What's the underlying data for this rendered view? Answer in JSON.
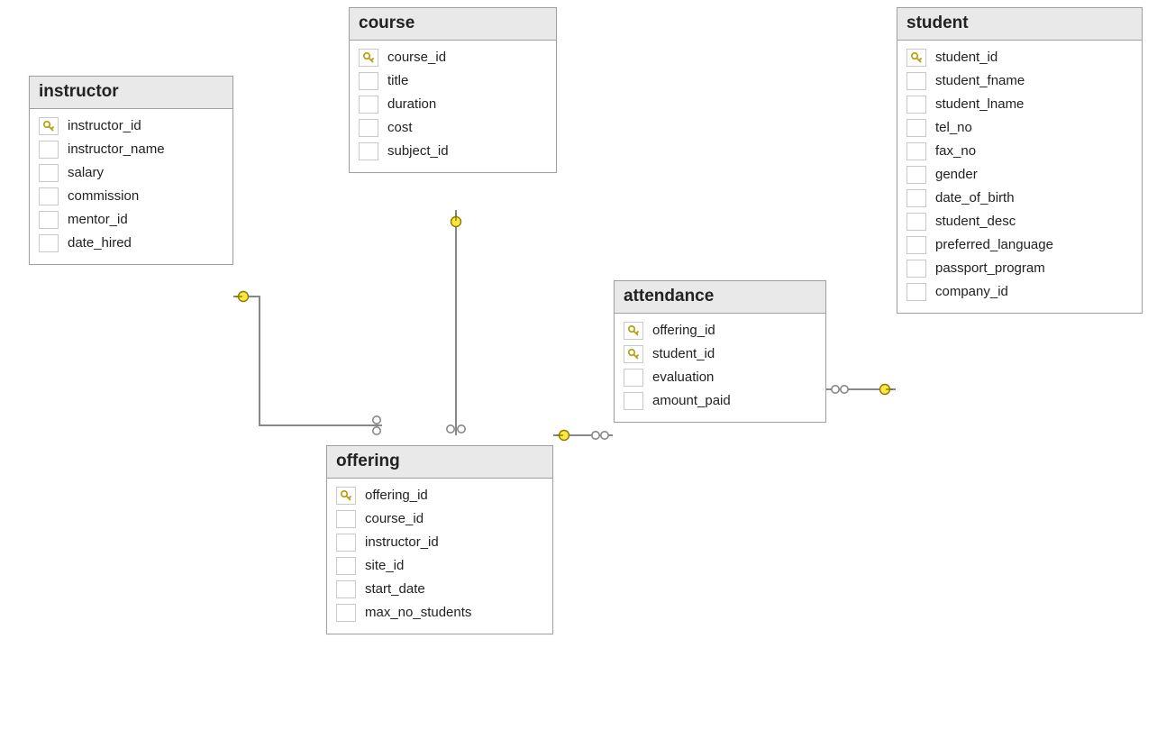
{
  "entities": {
    "instructor": {
      "name": "instructor",
      "columns": [
        {
          "name": "instructor_id",
          "pk": true
        },
        {
          "name": "instructor_name",
          "pk": false
        },
        {
          "name": "salary",
          "pk": false
        },
        {
          "name": "commission",
          "pk": false
        },
        {
          "name": "mentor_id",
          "pk": false
        },
        {
          "name": "date_hired",
          "pk": false
        }
      ]
    },
    "course": {
      "name": "course",
      "columns": [
        {
          "name": "course_id",
          "pk": true
        },
        {
          "name": "title",
          "pk": false
        },
        {
          "name": "duration",
          "pk": false
        },
        {
          "name": "cost",
          "pk": false
        },
        {
          "name": "subject_id",
          "pk": false
        }
      ]
    },
    "attendance": {
      "name": "attendance",
      "columns": [
        {
          "name": "offering_id",
          "pk": true
        },
        {
          "name": "student_id",
          "pk": true
        },
        {
          "name": "evaluation",
          "pk": false
        },
        {
          "name": "amount_paid",
          "pk": false
        }
      ]
    },
    "student": {
      "name": "student",
      "columns": [
        {
          "name": "student_id",
          "pk": true
        },
        {
          "name": "student_fname",
          "pk": false
        },
        {
          "name": "student_lname",
          "pk": false
        },
        {
          "name": "tel_no",
          "pk": false
        },
        {
          "name": "fax_no",
          "pk": false
        },
        {
          "name": "gender",
          "pk": false
        },
        {
          "name": "date_of_birth",
          "pk": false
        },
        {
          "name": "student_desc",
          "pk": false
        },
        {
          "name": "preferred_language",
          "pk": false
        },
        {
          "name": "passport_program",
          "pk": false
        },
        {
          "name": "company_id",
          "pk": false
        }
      ]
    },
    "offering": {
      "name": "offering",
      "columns": [
        {
          "name": "offering_id",
          "pk": true
        },
        {
          "name": "course_id",
          "pk": false
        },
        {
          "name": "instructor_id",
          "pk": false
        },
        {
          "name": "site_id",
          "pk": false
        },
        {
          "name": "start_date",
          "pk": false
        },
        {
          "name": "max_no_students",
          "pk": false
        }
      ]
    }
  },
  "relationships": [
    {
      "from": "instructor",
      "to": "offering",
      "from_card": "one",
      "to_card": "many"
    },
    {
      "from": "course",
      "to": "offering",
      "from_card": "one",
      "to_card": "many"
    },
    {
      "from": "offering",
      "to": "attendance",
      "from_card": "one",
      "to_card": "many"
    },
    {
      "from": "student",
      "to": "attendance",
      "from_card": "one",
      "to_card": "many"
    }
  ]
}
